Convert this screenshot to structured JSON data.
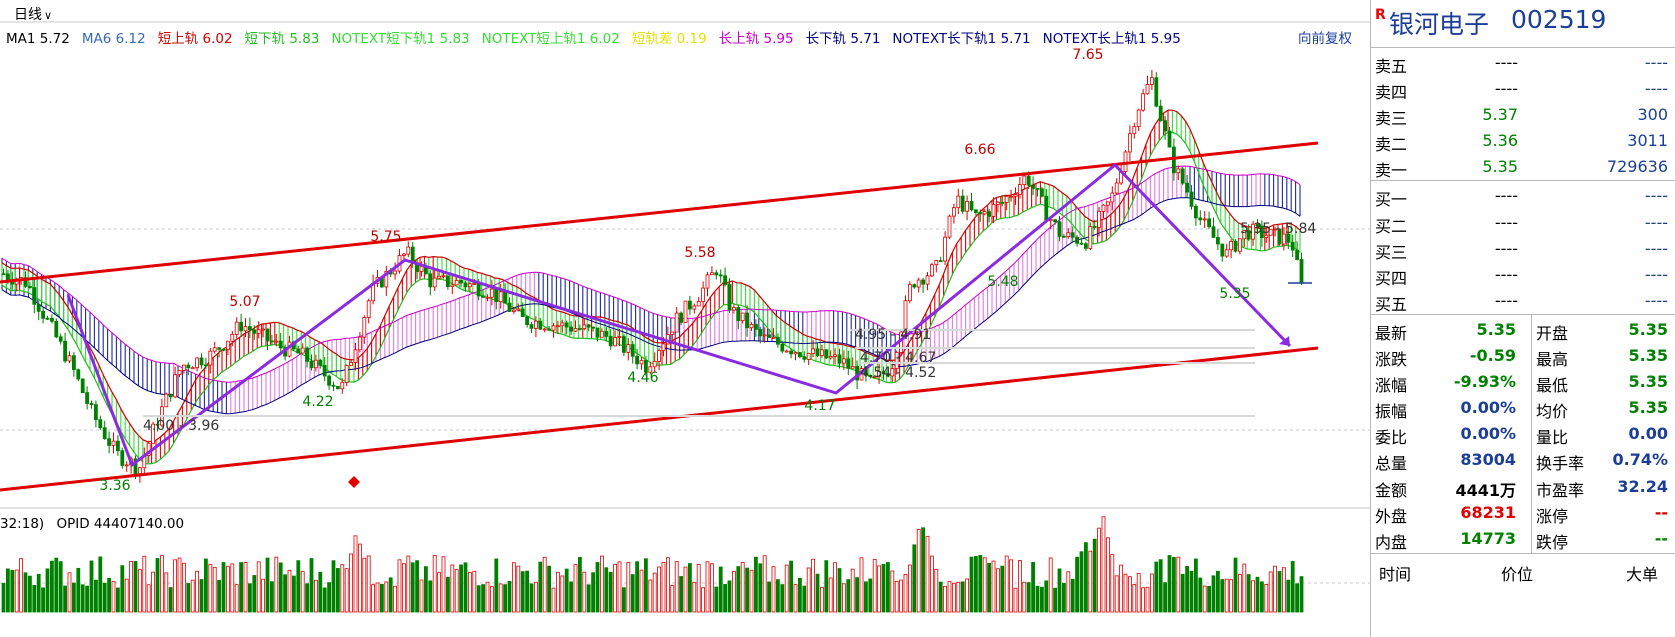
{
  "chart_header": {
    "period": "日线",
    "adjust": "向前复权",
    "indicators": [
      {
        "name": "MA1",
        "value": "5.72",
        "color": "#000000"
      },
      {
        "name": "MA6",
        "value": "6.12",
        "color": "#3a6ab5"
      },
      {
        "name": "短上轨",
        "value": "6.02",
        "color": "#d00000"
      },
      {
        "name": "短下轨",
        "value": "5.83",
        "color": "#22bb22"
      },
      {
        "name": "NOTEXT短下轨1",
        "value": "5.83",
        "color": "#33dd33"
      },
      {
        "name": "NOTEXT短上轨1",
        "value": "6.02",
        "color": "#33dd33"
      },
      {
        "name": "短轨差",
        "value": "0.19",
        "color": "#e8e000"
      },
      {
        "name": "长上轨",
        "value": "5.95",
        "color": "#cc00cc"
      },
      {
        "name": "长下轨",
        "value": "5.71",
        "color": "#000080"
      },
      {
        "name": "NOTEXT长下轨1",
        "value": "5.71",
        "color": "#000080"
      },
      {
        "name": "NOTEXT长上轨1",
        "value": "5.95",
        "color": "#000080"
      }
    ]
  },
  "volume_header": {
    "left_text": "32:18)",
    "opid_label": "OPID",
    "opid_value": "44407140.00"
  },
  "chart_data": {
    "type": "candlestick",
    "price_labels": [
      {
        "text": "7.65",
        "kind": "high"
      },
      {
        "text": "6.66",
        "kind": "high"
      },
      {
        "text": "5.75",
        "kind": "high"
      },
      {
        "text": "5.58",
        "kind": "high"
      },
      {
        "text": "5.07",
        "kind": "high"
      },
      {
        "text": "4.22",
        "kind": "low"
      },
      {
        "text": "4.46",
        "kind": "low"
      },
      {
        "text": "4.17",
        "kind": "low"
      },
      {
        "text": "3.36",
        "kind": "low"
      },
      {
        "text": "5.48",
        "kind": "low"
      },
      {
        "text": "5.35",
        "kind": "last"
      }
    ],
    "range_labels": [
      "4.00 - 3.96",
      "4.95 - 4.91",
      "4.70 - 4.67",
      "4.54 - 4.52",
      "5.35 - 5.84"
    ],
    "colors": {
      "up": "#e00000",
      "down": "#008000",
      "channel": "#e00000",
      "wave": "#8a2be2"
    }
  },
  "panel": {
    "badge": "R",
    "name": "银河电子",
    "code": "002519",
    "asks": [
      {
        "label": "卖五",
        "price": "----",
        "vol": "----"
      },
      {
        "label": "卖四",
        "price": "----",
        "vol": "----"
      },
      {
        "label": "卖三",
        "price": "5.37",
        "vol": "300"
      },
      {
        "label": "卖二",
        "price": "5.36",
        "vol": "3011"
      },
      {
        "label": "卖一",
        "price": "5.35",
        "vol": "729636"
      }
    ],
    "bids": [
      {
        "label": "买一",
        "price": "----",
        "vol": "----"
      },
      {
        "label": "买二",
        "price": "----",
        "vol": "----"
      },
      {
        "label": "买三",
        "price": "----",
        "vol": "----"
      },
      {
        "label": "买四",
        "price": "----",
        "vol": "----"
      },
      {
        "label": "买五",
        "price": "----",
        "vol": "----"
      }
    ],
    "stats": [
      {
        "l1": "最新",
        "v1": "5.35",
        "c1": "green",
        "l2": "开盘",
        "v2": "5.35",
        "c2": "green"
      },
      {
        "l1": "涨跌",
        "v1": "-0.59",
        "c1": "green",
        "l2": "最高",
        "v2": "5.35",
        "c2": "green"
      },
      {
        "l1": "涨幅",
        "v1": "-9.93%",
        "c1": "green",
        "l2": "最低",
        "v2": "5.35",
        "c2": "green"
      },
      {
        "l1": "振幅",
        "v1": "0.00%",
        "c1": "navy",
        "l2": "均价",
        "v2": "5.35",
        "c2": "green"
      },
      {
        "l1": "委比",
        "v1": "0.00%",
        "c1": "navy",
        "l2": "量比",
        "v2": "0.00",
        "c2": "navy"
      },
      {
        "l1": "总量",
        "v1": "83004",
        "c1": "navy",
        "l2": "换手率",
        "v2": "0.74%",
        "c2": "navy"
      },
      {
        "l1": "金额",
        "v1": "4441万",
        "c1": "black",
        "l2": "市盈率",
        "v2": "32.24",
        "c2": "navy"
      },
      {
        "l1": "外盘",
        "v1": "68231",
        "c1": "red",
        "l2": "涨停",
        "v2": "--",
        "c2": "red"
      },
      {
        "l1": "内盘",
        "v1": "14773",
        "c1": "green",
        "l2": "跌停",
        "v2": "--",
        "c2": "green"
      }
    ],
    "tick_headers": [
      "时间",
      "价位",
      "大单"
    ]
  }
}
